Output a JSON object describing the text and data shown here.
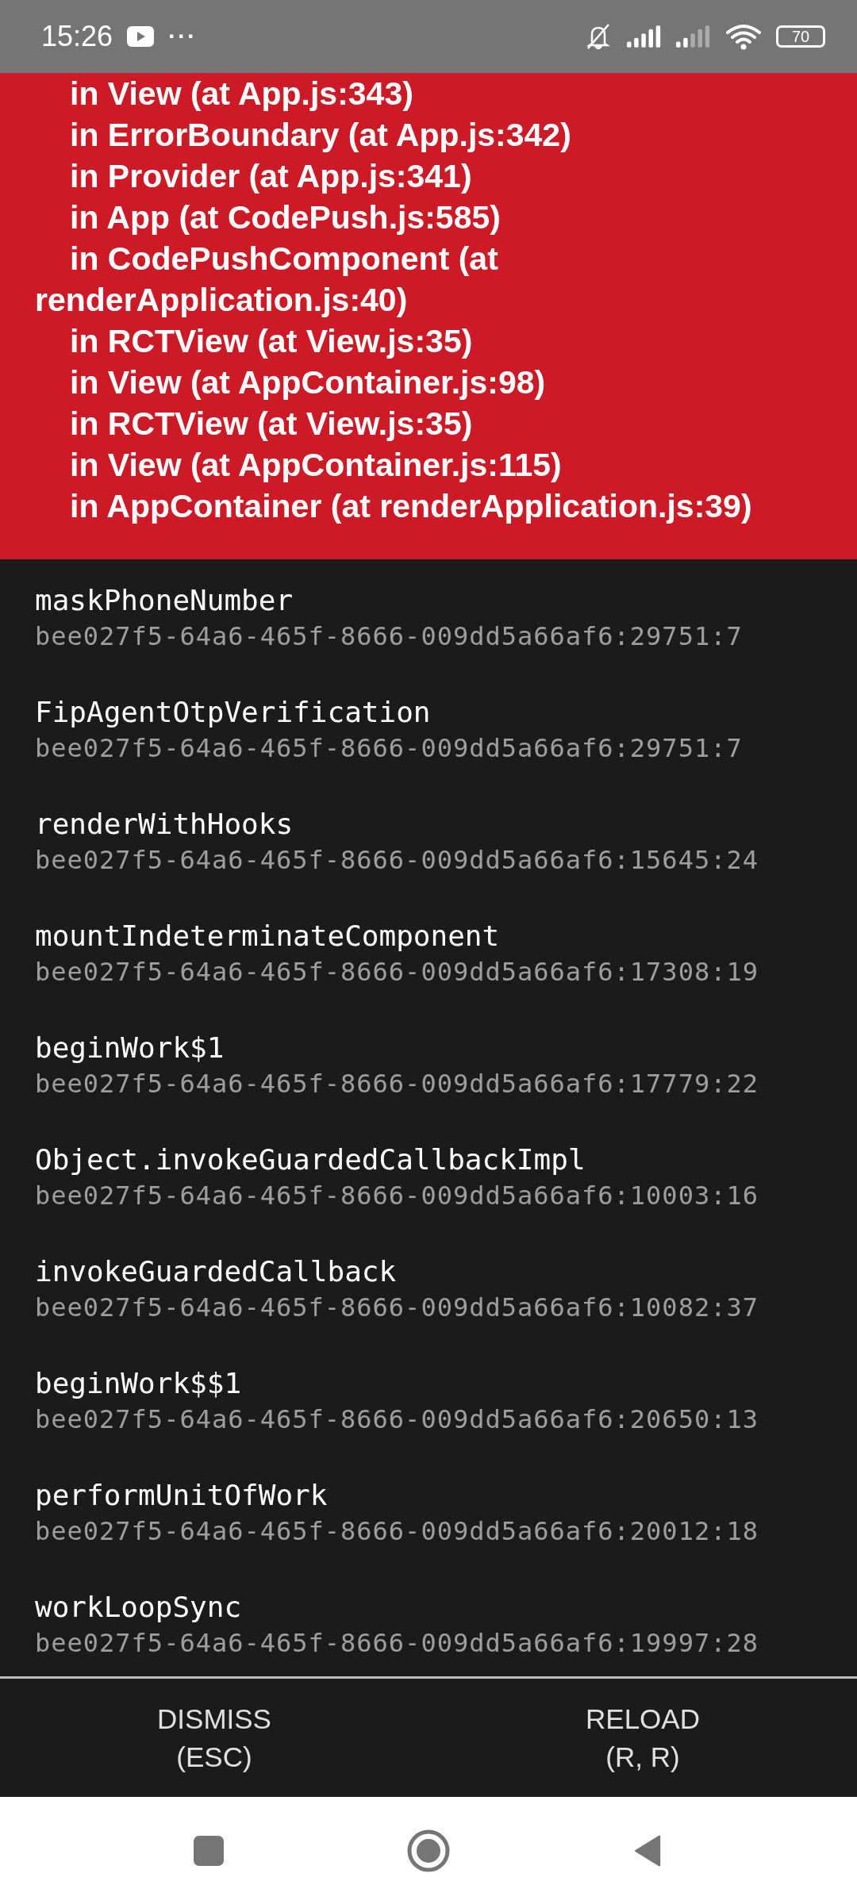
{
  "status_bar": {
    "time": "15:26",
    "more": "···",
    "battery": "70"
  },
  "error_stack": [
    {
      "kind": "frame",
      "text": "in View (at App.js:343)"
    },
    {
      "kind": "frame",
      "text": "in ErrorBoundary (at App.js:342)"
    },
    {
      "kind": "frame",
      "text": "in Provider (at App.js:341)"
    },
    {
      "kind": "frame",
      "text": "in App (at CodePush.js:585)"
    },
    {
      "kind": "frame",
      "text": "in CodePushComponent (at"
    },
    {
      "kind": "continuation",
      "text": "renderApplication.js:40)"
    },
    {
      "kind": "frame",
      "text": "in RCTView (at View.js:35)"
    },
    {
      "kind": "frame",
      "text": "in View (at AppContainer.js:98)"
    },
    {
      "kind": "frame",
      "text": "in RCTView (at View.js:35)"
    },
    {
      "kind": "frame",
      "text": "in View (at AppContainer.js:115)"
    },
    {
      "kind": "frame",
      "text": "in AppContainer (at renderApplication.js:39)"
    }
  ],
  "call_stack": [
    {
      "method": "maskPhoneNumber",
      "location": "bee027f5-64a6-465f-8666-009dd5a66af6:29751:7"
    },
    {
      "method": "FipAgentOtpVerification",
      "location": "bee027f5-64a6-465f-8666-009dd5a66af6:29751:7"
    },
    {
      "method": "renderWithHooks",
      "location": "bee027f5-64a6-465f-8666-009dd5a66af6:15645:24"
    },
    {
      "method": "mountIndeterminateComponent",
      "location": "bee027f5-64a6-465f-8666-009dd5a66af6:17308:19"
    },
    {
      "method": "beginWork$1",
      "location": "bee027f5-64a6-465f-8666-009dd5a66af6:17779:22"
    },
    {
      "method": "Object.invokeGuardedCallbackImpl",
      "location": "bee027f5-64a6-465f-8666-009dd5a66af6:10003:16"
    },
    {
      "method": "invokeGuardedCallback",
      "location": "bee027f5-64a6-465f-8666-009dd5a66af6:10082:37"
    },
    {
      "method": "beginWork$$1",
      "location": "bee027f5-64a6-465f-8666-009dd5a66af6:20650:13"
    },
    {
      "method": "performUnitOfWork",
      "location": "bee027f5-64a6-465f-8666-009dd5a66af6:20012:18"
    },
    {
      "method": "workLoopSync",
      "location": "bee027f5-64a6-465f-8666-009dd5a66af6:19997:28"
    }
  ],
  "buttons": [
    {
      "label": "DISMISS",
      "shortcut": "(ESC)"
    },
    {
      "label": "RELOAD",
      "shortcut": "(R, R)"
    }
  ]
}
